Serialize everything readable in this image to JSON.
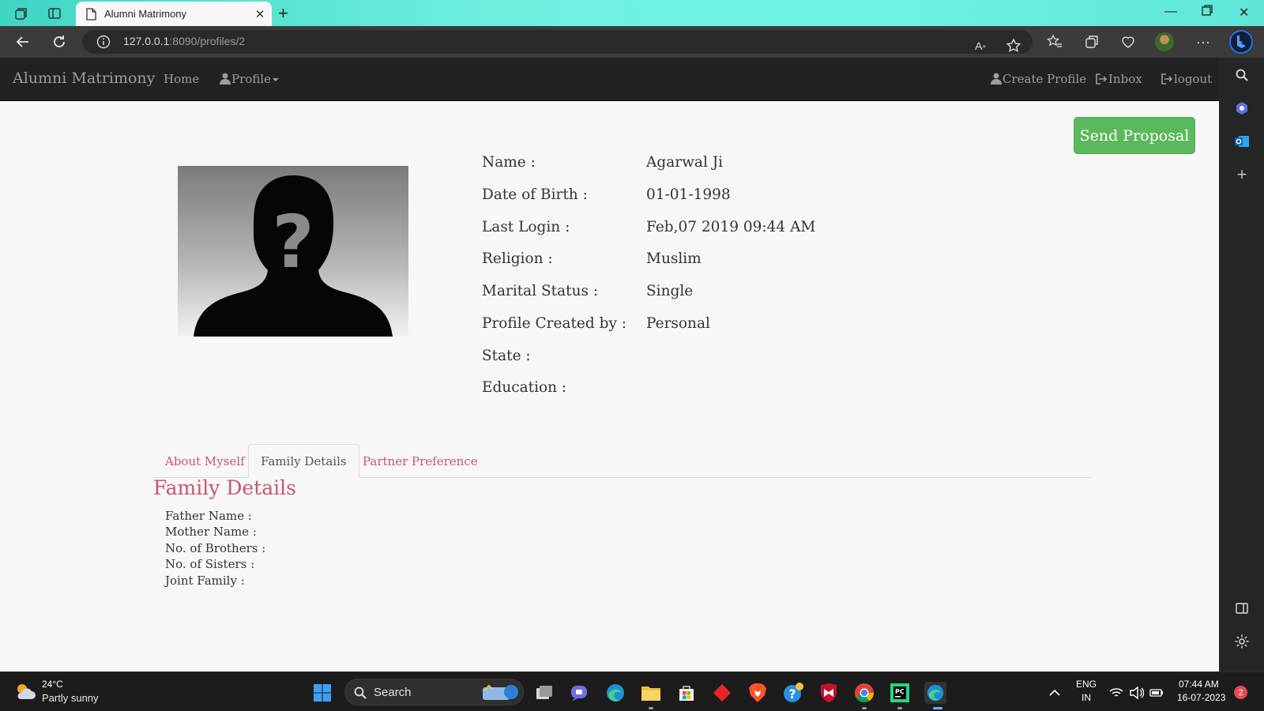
{
  "browser": {
    "tab_title": "Alumni Matrimony",
    "url_host": "127.0.0.1",
    "url_rest": ":8090/profiles/2"
  },
  "site": {
    "brand": "Alumni Matrimony",
    "nav_left": {
      "home": "Home",
      "profile": "Profile"
    },
    "nav_right": {
      "create_profile": "Create Profile",
      "inbox": "Inbox",
      "logout": "logout"
    }
  },
  "page": {
    "send_proposal": "Send Proposal",
    "profile": {
      "labels": {
        "name": "Name :",
        "dob": "Date of Birth :",
        "last_login": "Last Login :",
        "religion": "Religion :",
        "marital_status": "Marital Status :",
        "created_by": "Profile Created by :",
        "state": "State :",
        "education": "Education :"
      },
      "values": {
        "name": "Agarwal Ji",
        "dob": "01-01-1998",
        "last_login": "Feb,07 2019 09:44 AM",
        "religion": "Muslim",
        "marital_status": "Single",
        "created_by": "Personal",
        "state": "",
        "education": ""
      }
    },
    "tabs": {
      "about": "About Myself",
      "family": "Family Details",
      "partner": "Partner Preference"
    },
    "family": {
      "title": "Family Details",
      "father": "Father Name :",
      "mother": "Mother Name :",
      "brothers": "No. of Brothers :",
      "sisters": "No. of Sisters :",
      "joint": "Joint Family :"
    }
  },
  "taskbar": {
    "weather_temp": "24°C",
    "weather_desc": "Partly sunny",
    "search": "Search",
    "lang_1": "ENG",
    "lang_2": "IN",
    "time": "07:44 AM",
    "date": "16-07-2023",
    "notifications": "2"
  },
  "colors": {
    "navbar": "#222222",
    "send_button": "#5cb85c",
    "tab_link": "#c9566e",
    "tabbar_accent": "#6ff0df"
  }
}
